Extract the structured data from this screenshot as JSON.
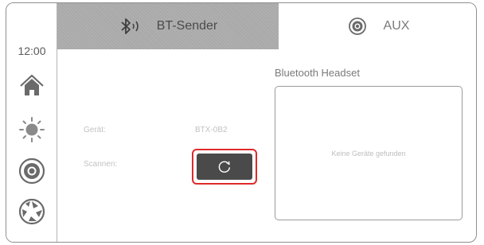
{
  "sidebar": {
    "clock": "12:00",
    "items": [
      {
        "icon": "home-icon"
      },
      {
        "icon": "brightness-icon"
      },
      {
        "icon": "audio-source-icon"
      },
      {
        "icon": "shutter-icon"
      }
    ]
  },
  "tabs": [
    {
      "label": "BT-Sender",
      "icon": "bluetooth-icon",
      "active": true
    },
    {
      "label": "AUX",
      "icon": "aux-icon",
      "active": false
    }
  ],
  "main": {
    "device_label": "Gerät:",
    "device_value": "BTX-0B2",
    "scan_label": "Scannen:",
    "scan_icon": "refresh-icon"
  },
  "headset": {
    "title": "Bluetooth Headset",
    "empty_message": "Keine Geräte gefunden"
  },
  "colors": {
    "highlight": "#e02a2a",
    "active_tab": "#a9a9a9",
    "button": "#4a4a4a"
  }
}
